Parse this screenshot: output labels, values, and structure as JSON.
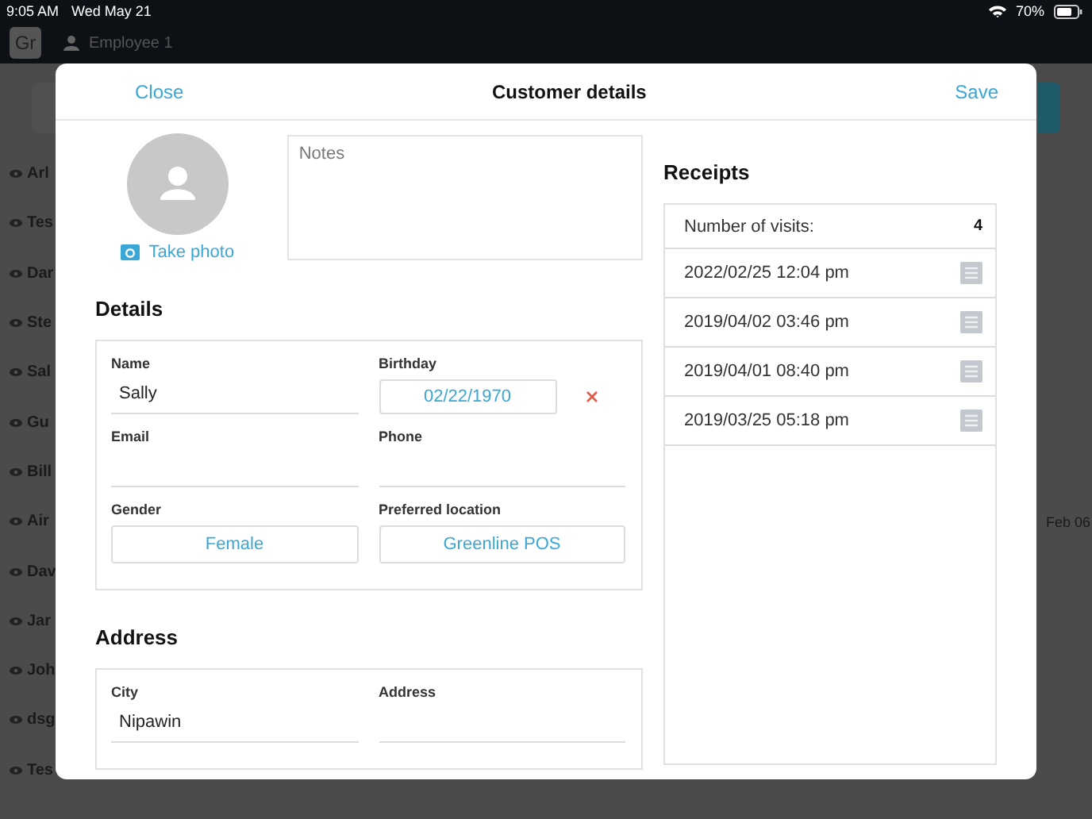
{
  "status_bar": {
    "time": "9:05 AM",
    "date": "Wed May 21",
    "battery": "70%"
  },
  "app_bar": {
    "logo": "Gr",
    "employee": "Employee 1"
  },
  "background_list": [
    {
      "name": "Arl"
    },
    {
      "name": "Tes"
    },
    {
      "name": "Dar"
    },
    {
      "name": "Ste"
    },
    {
      "name": "Sal"
    },
    {
      "name": "Gu"
    },
    {
      "name": "Bill"
    },
    {
      "name": "Air",
      "date": "Feb 06"
    },
    {
      "name": "Dav"
    },
    {
      "name": "Jar"
    },
    {
      "name": "Joh"
    },
    {
      "name": "dsg"
    },
    {
      "name": "Tes"
    }
  ],
  "modal": {
    "title": "Customer details",
    "close": "Close",
    "save": "Save",
    "take_photo": "Take photo",
    "notes_placeholder": "Notes",
    "details": {
      "title": "Details",
      "fields": [
        {
          "kind": "text",
          "label": "Name",
          "value": "Sally"
        },
        {
          "kind": "date",
          "label": "Birthday",
          "value": "02/22/1970"
        },
        {
          "kind": "text",
          "label": "Email"
        },
        {
          "kind": "text",
          "label": "Phone"
        },
        {
          "kind": "select",
          "label": "Gender",
          "value": "Female"
        },
        {
          "kind": "select",
          "label": "Preferred location",
          "value": "Greenline POS"
        }
      ]
    },
    "address": {
      "title": "Address",
      "fields": [
        {
          "kind": "text",
          "label": "City",
          "value": "Nipawin"
        },
        {
          "kind": "text",
          "label": "Address"
        }
      ]
    },
    "receipts": {
      "title": "Receipts",
      "visits_label": "Number of visits:",
      "visits_count": "4",
      "items": [
        {
          "date": "2022/02/25 12:04 pm"
        },
        {
          "date": "2019/04/02 03:46 pm"
        },
        {
          "date": "2019/04/01 08:40 pm"
        },
        {
          "date": "2019/03/25 05:18 pm"
        }
      ]
    }
  }
}
